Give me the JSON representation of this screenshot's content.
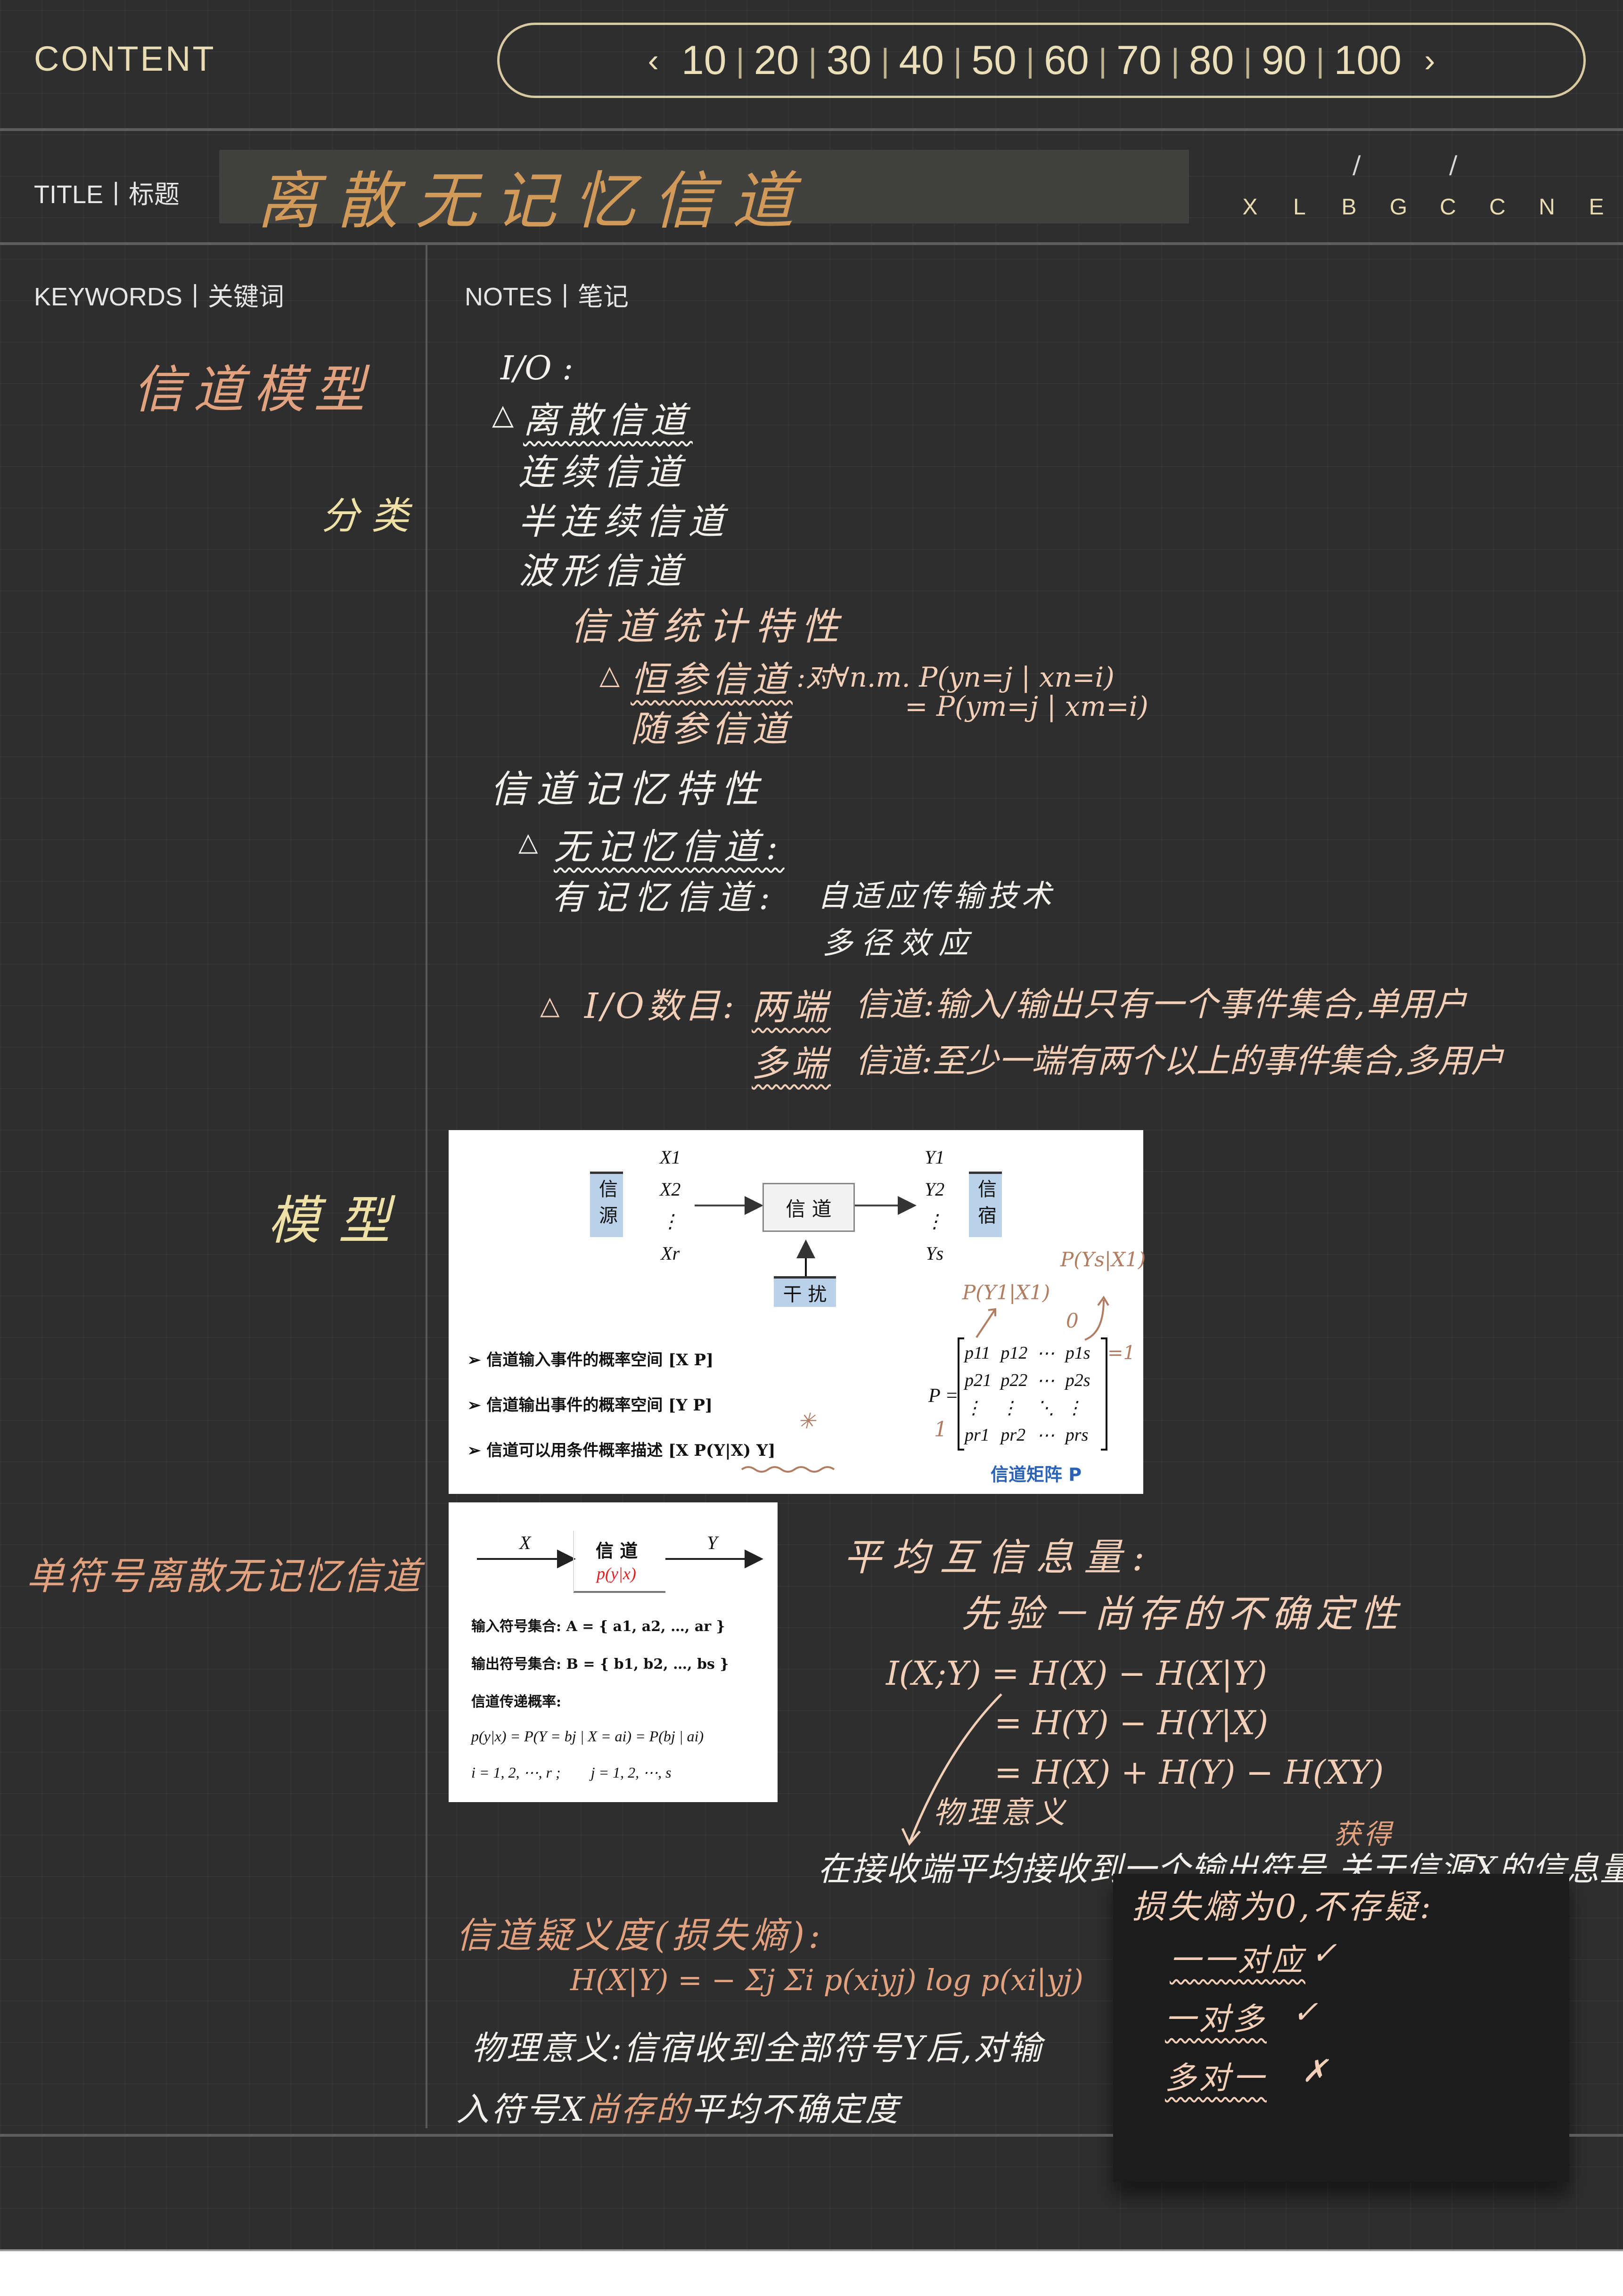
{
  "header": {
    "content_label": "CONTENT",
    "pager": {
      "prev_icon": "‹",
      "next_icon": "›",
      "pages": [
        "10",
        "20",
        "30",
        "40",
        "50",
        "60",
        "70",
        "80",
        "90",
        "100"
      ],
      "separator": "|"
    },
    "title_label": "TITLE丨标题",
    "title_text": "离散无记忆信道",
    "date_slashes": [
      "/",
      "/"
    ],
    "date_letters": [
      "X",
      "L",
      "B",
      "G",
      "C",
      "C",
      "N",
      "E"
    ]
  },
  "sections": {
    "keywords_label": "KEYWORDS丨关键词",
    "notes_label": "NOTES丨笔记"
  },
  "keywords": [
    {
      "text": "信道模型",
      "color": "salmon"
    },
    {
      "text": "分类",
      "color": "gold"
    },
    {
      "text": "模型",
      "color": "gold"
    },
    {
      "text": "单符号离散无记忆信道",
      "color": "salmon"
    }
  ],
  "notes": {
    "io_heading": "I/O :",
    "io_list": {
      "bullet": "△",
      "items": [
        "离散信道",
        "连续信道",
        "半连续信道",
        "波形信道"
      ]
    },
    "stat_heading": "信道统计特性",
    "stat_items": {
      "bullet": "△",
      "constant": "恒参信道",
      "constant_def": ":对∀n.m.  P(yn=j | xn=i)",
      "constant_def2": "= P(ym=j | xm=i)",
      "random": "随参信道"
    },
    "memory_heading": "信道记忆特性",
    "memory_items": {
      "bullet": "△",
      "memoryless": "无记忆信道:",
      "with_memory": "有记忆信道:",
      "with_memory_def1": "自适应传输技术",
      "with_memory_def2": "多径效应"
    },
    "io_count": {
      "bullet": "△",
      "label": "I/O数目:",
      "two_port": "两端",
      "two_port_rest": "信道:输入/输出只有一个事件集合,单用户",
      "multi_port": "多端",
      "multi_port_rest": "信道:至少一端有两个以上的事件集合,多用户"
    },
    "mutual_info": {
      "heading": "平均互信息量:",
      "subheading": "先验－尚存的不确定性",
      "eq1": "I(X;Y) = H(X) − H(X|Y)",
      "eq2": "= H(Y) − H(Y|X)",
      "eq3": "= H(X) + H(Y) − H(XY)",
      "meaning_label": "物理意义",
      "gain_note": "获得",
      "meaning_text": "在接收端平均接收到一个输出符号,关于信源X的信息量"
    },
    "equivocation": {
      "heading": "信道疑义度(损失熵):",
      "formula": "H(X|Y) = − Σj Σi p(xiyj) log p(xi|yj)",
      "meaning_prefix": "物理意义:信宿收到全部符号Y后,对输",
      "meaning_line2_a": "入符号X",
      "meaning_line2_b": "尚存的",
      "meaning_line2_c": "平均不确定度"
    },
    "sticky_note": {
      "heading": "损失熵为0,不存疑:",
      "items": [
        {
          "label": "一一对应",
          "mark": "✓"
        },
        {
          "label": "一对多",
          "mark": "✓"
        },
        {
          "label": "多对一",
          "mark": "✗"
        }
      ]
    }
  },
  "figure1": {
    "source_label": "信源",
    "sink_label": "信宿",
    "channel_label": "信 道",
    "noise_label": "干 扰",
    "inputs": [
      "X1",
      "X2",
      "⋮",
      "Xr"
    ],
    "outputs": [
      "Y1",
      "Y2",
      "⋮",
      "Ys"
    ],
    "bullets": [
      "信道输入事件的概率空间 [X P]",
      "信道输出事件的概率空间 [Y P]",
      "信道可以用条件概率描述 [X  P(Y|X)  Y]"
    ],
    "annot_star": "✳",
    "matrix_lhs": "P =",
    "matrix_rows": [
      [
        "p11",
        "p12",
        "⋯",
        "p1s"
      ],
      [
        "p21",
        "p22",
        "⋯",
        "p2s"
      ],
      [
        "⋮",
        "⋮",
        "⋱",
        "⋮"
      ],
      [
        "pr1",
        "pr2",
        "⋯",
        "prs"
      ]
    ],
    "matrix_caption": "信道矩阵 P",
    "annot_p11": "P(Y1|X1)",
    "annot_p1s": "P(Ys|X1)",
    "annot_zero": "0",
    "annot_row_sum": "=1",
    "annot_one": "1"
  },
  "figure2": {
    "x_label": "X",
    "y_label": "Y",
    "channel_label": "信 道",
    "channel_prob": "p(y|x)",
    "input_set": "输入符号集合: A = { a1, a2, …, ar }",
    "output_set": "输出符号集合: B = { b1, b2, …, bs }",
    "trans_label": "信道传递概率:",
    "trans_formula": "p(y|x) = P(Y = bj | X = ai) = P(bj | ai)",
    "indices": "i = 1, 2, ⋯, r ;        j = 1, 2, ⋯, s"
  },
  "colors": {
    "background": "#2e2e2e",
    "gold": "#e9dcb3",
    "title_orange": "#d29a58",
    "salmon": "#e2a17f",
    "peach": "#f3cfb8",
    "chalk_white": "#f4f1ec",
    "figure_blue": "#b9d2ea",
    "caption_blue": "#2a62b8",
    "prob_red": "#e02020"
  }
}
